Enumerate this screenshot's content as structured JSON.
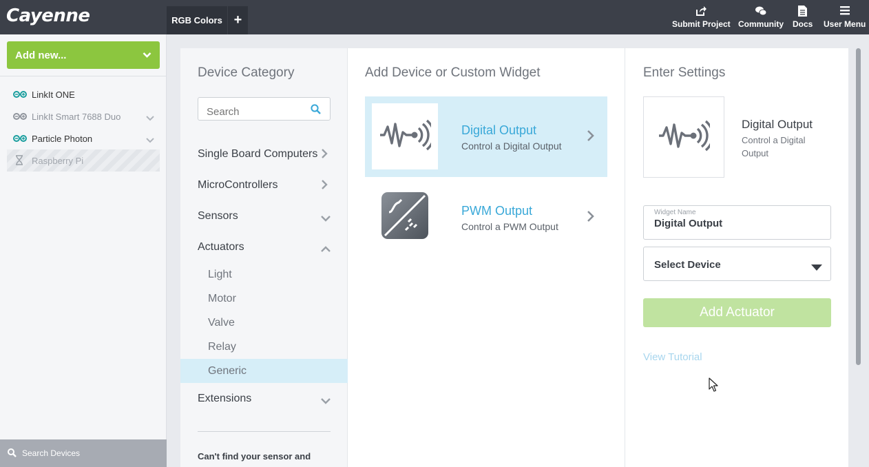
{
  "header": {
    "logo": "Cayenne",
    "active_tab": "RGB Colors",
    "add_tab": "+",
    "nav": [
      {
        "label": "Submit Project",
        "icon": "share-icon"
      },
      {
        "label": "Community",
        "icon": "chat-icon"
      },
      {
        "label": "Docs",
        "icon": "document-icon"
      },
      {
        "label": "User Menu",
        "icon": "hamburger-icon"
      }
    ]
  },
  "sidebar": {
    "add_new": "Add new...",
    "devices": [
      {
        "label": "LinkIt ONE",
        "status": "online"
      },
      {
        "label": "LinkIt Smart 7688 Duo",
        "status": "offline"
      },
      {
        "label": "Particle Photon",
        "status": "online"
      },
      {
        "label": "Raspberry Pi",
        "status": "pending"
      }
    ],
    "search": "Search Devices"
  },
  "category": {
    "title": "Device Category",
    "search_placeholder": "Search",
    "items": [
      {
        "label": "Single Board Computers"
      },
      {
        "label": "MicroControllers"
      },
      {
        "label": "Sensors"
      },
      {
        "label": "Actuators"
      },
      {
        "label": "Extensions"
      }
    ],
    "actuator_subitems": [
      {
        "label": "Light"
      },
      {
        "label": "Motor"
      },
      {
        "label": "Valve"
      },
      {
        "label": "Relay"
      },
      {
        "label": "Generic"
      }
    ],
    "cant_find": "Can't find your sensor and"
  },
  "widgets": {
    "title": "Add Device or Custom Widget",
    "items": [
      {
        "name": "Digital Output",
        "desc": "Control a Digital Output",
        "selected": true
      },
      {
        "name": "PWM Output",
        "desc": "Control a PWM Output",
        "selected": false
      }
    ]
  },
  "settings": {
    "title": "Enter Settings",
    "preview_name": "Digital Output",
    "preview_desc": "Control a Digital Output",
    "widget_name_label": "Widget Name",
    "widget_name_value": "Digital Output",
    "select_device": "Select Device",
    "add_button": "Add Actuator",
    "tutorial_link": "View Tutorial"
  },
  "colors": {
    "topbar": "#3c4049",
    "brand_green": "#8cc63f",
    "link_blue": "#39a8d8",
    "selected_bg": "#d6eef8"
  }
}
